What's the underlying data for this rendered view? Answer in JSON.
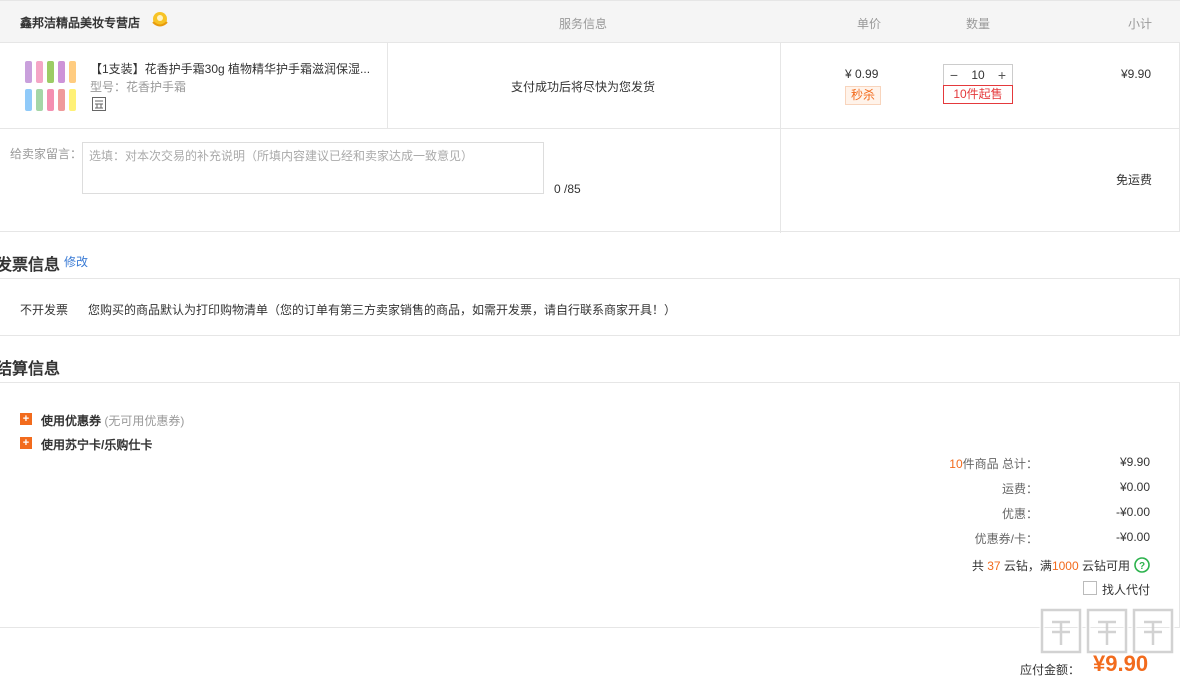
{
  "shop": {
    "name": "鑫邦洁精品美妆专营店",
    "badge_icon": "shop-badge-icon"
  },
  "columns": {
    "service": "服务信息",
    "unit_price": "单价",
    "quantity": "数量",
    "subtotal": "小计"
  },
  "item": {
    "title": "【1支装】花香护手霜30g 植物精华护手霜滋润保湿...",
    "model": "型号：花香护手霜",
    "service": "支付成功后将尽快为您发货",
    "price": "¥ 0.99",
    "tag": "秒杀",
    "quantity": "10",
    "min_order": "10件起售",
    "subtotal": "¥9.90"
  },
  "message": {
    "label": "给卖家留言：",
    "placeholder": "选填：对本次交易的补充说明（所填内容建议已经和卖家达成一致意见）",
    "count": "0 /85"
  },
  "shipping": "免运费",
  "invoice": {
    "section_title": "发票信息",
    "modify": "修改",
    "type": "不开发票",
    "note": "您购买的商品默认为打印购物清单（您的订单有第三方卖家销售的商品，如需开发票，请自行联系商家开具！）"
  },
  "settlement": {
    "section_title": "结算信息",
    "coupon": {
      "label": "使用优惠券",
      "note": "(无可用优惠券)"
    },
    "card": {
      "label": "使用苏宁卡/乐购仕卡"
    },
    "summary": {
      "count": "10",
      "count_suffix": "件商品 总计：",
      "total": "¥9.90",
      "freight_label": "运费：",
      "freight": "¥0.00",
      "discount_label": "优惠：",
      "discount": "-¥0.00",
      "coupon_label": "优惠券/卡：",
      "coupon_value": "-¥0.00"
    },
    "coins": {
      "prefix": "共",
      "amount": "37",
      "mid": "云钻，满",
      "threshold": "1000",
      "suffix": "云钻可用"
    },
    "proxy_pay": "找人代付",
    "payable_label": "应付金额：",
    "payable": "¥9.90"
  },
  "colors": {
    "accent": "#f26b1d",
    "red": "#e4393c",
    "link": "#3a7bd5",
    "help": "#2bb24c"
  }
}
